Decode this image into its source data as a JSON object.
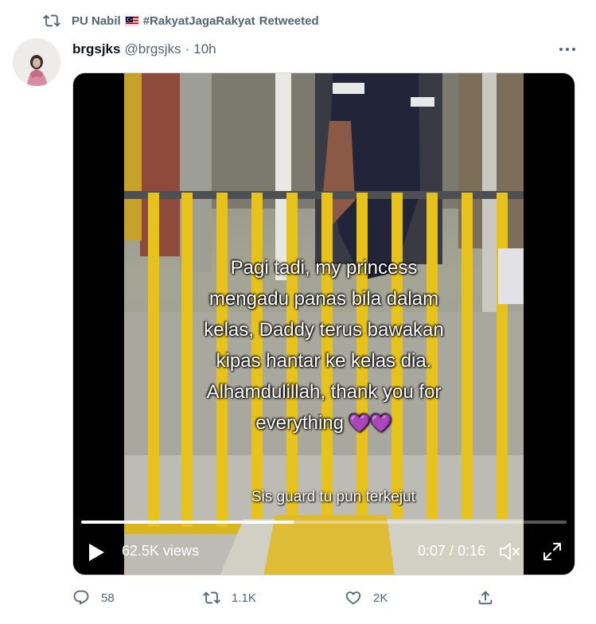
{
  "retweet": {
    "user": "PU Nabil",
    "flag": "flag-malaysia-icon",
    "hashtag": "#RakyatJagaRakyat",
    "suffix": "Retweeted"
  },
  "tweet": {
    "name": "brgsjks",
    "handle": "@brgsjks",
    "separator": "·",
    "time": "10h"
  },
  "video": {
    "caption_lines": [
      "Pagi tadi, my princess",
      "mengadu panas bila dalam",
      "kelas, Daddy terus bawakan",
      "kipas hantar ke kelas dia.",
      "Alhamdulillah, thank you for",
      "everything"
    ],
    "caption_emoji": "💜💜",
    "sub_caption": "Sis guard tu pun terkejut",
    "views": "62.5K views",
    "time_display": "0:07 / 0:16",
    "progress": 0.44
  },
  "actions": {
    "replies": "58",
    "retweets": "1.1K",
    "likes": "2K"
  },
  "colors": {
    "muted": "#536471",
    "text": "#0f1419",
    "fence_yellow": "#e7c21a"
  }
}
